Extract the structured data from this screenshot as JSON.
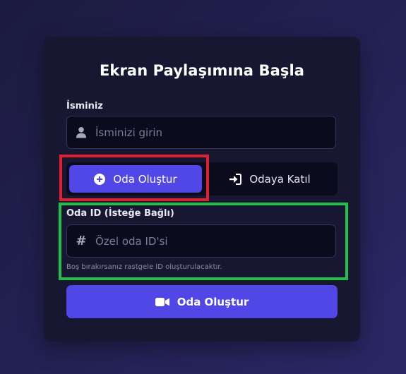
{
  "card": {
    "title": "Ekran Paylaşımına Başla"
  },
  "name_field": {
    "label": "İsminiz",
    "placeholder": "İsminizi girin",
    "value": "",
    "icon": "user-icon"
  },
  "mode_tabs": {
    "create": {
      "label": "Oda Oluştur",
      "icon": "plus-circle-icon",
      "active": true
    },
    "join": {
      "label": "Odaya Katıl",
      "icon": "sign-in-icon",
      "active": false
    }
  },
  "room_field": {
    "label": "Oda ID (İsteğe Bağlı)",
    "placeholder": "Özel oda ID'si",
    "value": "",
    "icon": "hashtag-icon",
    "hint": "Boş bırakırsanız rastgele ID oluşturulacaktır."
  },
  "submit": {
    "label": "Oda Oluştur",
    "icon": "video-camera-icon"
  },
  "colors": {
    "accent": "#5146e6",
    "highlight_red": "#e02030",
    "highlight_green": "#1fc04a"
  }
}
